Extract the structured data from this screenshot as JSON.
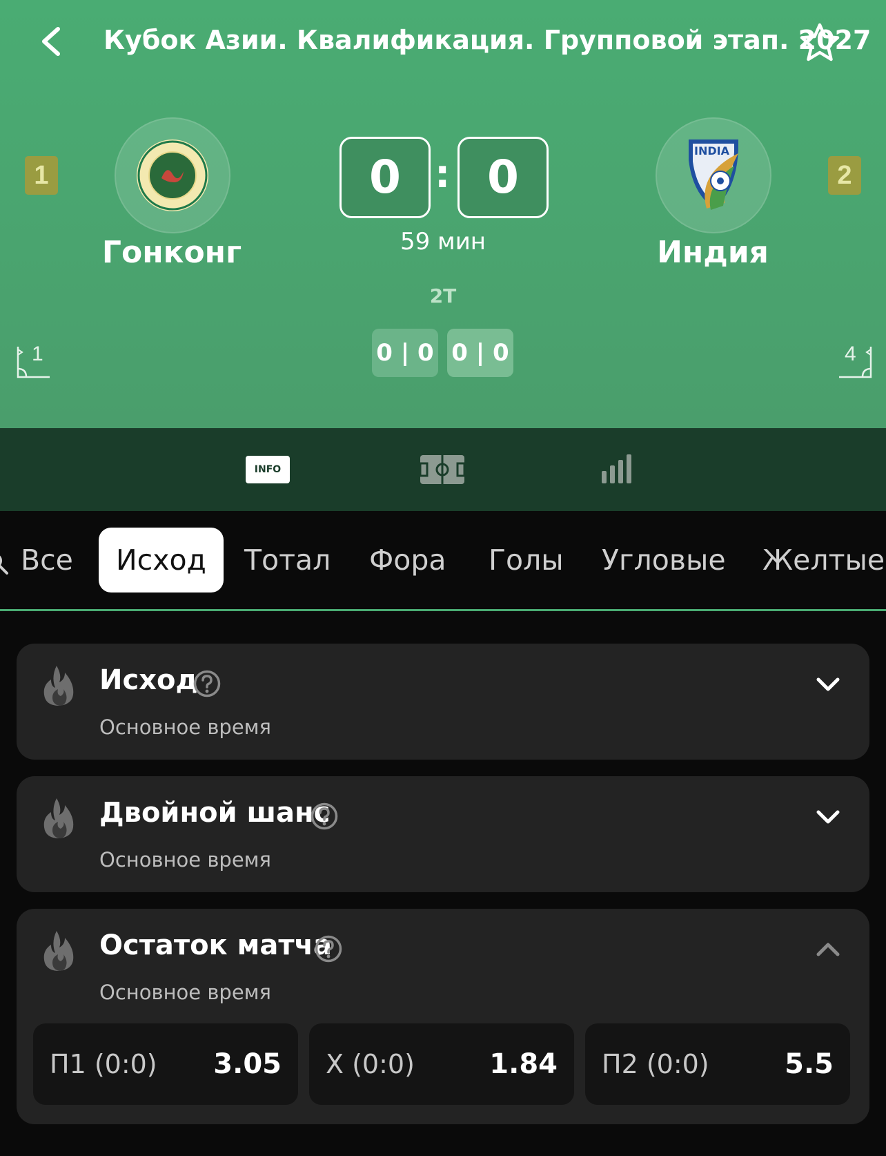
{
  "header": {
    "title": "Кубок Азии. Квалификация. Групповой этап. 2027",
    "back_icon": "chevron-left-icon",
    "favorite_icon": "star-outline-icon"
  },
  "match": {
    "home": {
      "name": "Гонконг",
      "rank": "1",
      "corners": "1",
      "logo": "hong-kong-fa-crest"
    },
    "away": {
      "name": "Индия",
      "rank": "2",
      "corners": "4",
      "logo": "india-fa-crest",
      "logo_text": "INDIA"
    },
    "score": {
      "home": "0",
      "separator": ":",
      "away": "0"
    },
    "minute": "59 мин",
    "period": "2Т",
    "half_scores": [
      "0 | 0",
      "0 | 0"
    ]
  },
  "nav": {
    "info_label": "INFO",
    "field_icon": "field-icon",
    "stats_icon": "stats-bars-icon"
  },
  "tabs": [
    "Все",
    "Исход",
    "Тотал",
    "Фора",
    "Голы",
    "Угловые",
    "Желтые к"
  ],
  "active_tab": "Исход",
  "markets": [
    {
      "title": "Исход",
      "subtitle": "Основное время",
      "expanded": false
    },
    {
      "title": "Двойной шанс",
      "subtitle": "Основное время",
      "expanded": false
    },
    {
      "title": "Остаток матча",
      "subtitle": "Основное время",
      "expanded": true,
      "odds": [
        {
          "label": "П1 (0:0)",
          "value": "3.05"
        },
        {
          "label": "Х (0:0)",
          "value": "1.84"
        },
        {
          "label": "П2 (0:0)",
          "value": "5.5"
        }
      ]
    }
  ],
  "colors": {
    "header_green": "#4aac73",
    "nav_dark_green": "#1a3d2a",
    "card_bg": "#232323",
    "rank_badge": "#9a9c41"
  }
}
